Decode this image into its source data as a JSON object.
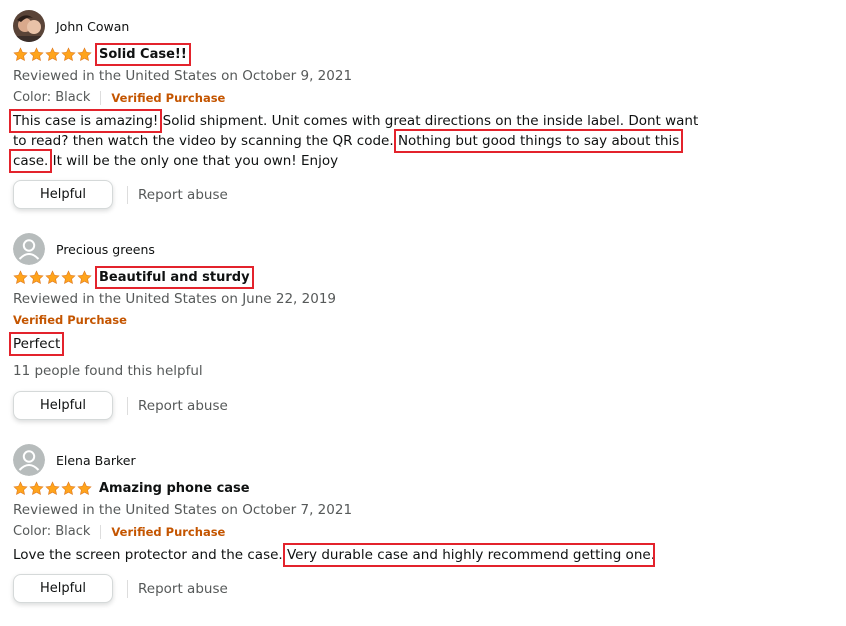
{
  "reviews": [
    {
      "reviewer": "John Cowan",
      "avatar": "profile-photo",
      "rating": 5,
      "title": "Solid Case!!",
      "date_line": "Reviewed in the United States on October 9, 2021",
      "color": "Color: Black",
      "verified": "Verified Purchase",
      "body_parts": [
        "This case is amazing!",
        " Solid shipment. Unit comes with great directions on the inside label. Dont want to read? then watch the video by scanning the QR code. ",
        "Nothing but good things to say about this case.",
        " It will be the only one that you own! Enjoy"
      ],
      "helpful_label": "Helpful",
      "report_label": "Report abuse"
    },
    {
      "reviewer": "Precious greens",
      "avatar": "default-avatar",
      "rating": 5,
      "title": "Beautiful and sturdy",
      "date_line": "Reviewed in the United States on June 22, 2019",
      "verified": "Verified Purchase",
      "body_parts": [
        "Perfect"
      ],
      "helpful_count": "11 people found this helpful",
      "helpful_label": "Helpful",
      "report_label": "Report abuse"
    },
    {
      "reviewer": "Elena Barker",
      "avatar": "default-avatar",
      "rating": 5,
      "title": "Amazing phone case",
      "date_line": "Reviewed in the United States on October 7, 2021",
      "color": "Color: Black",
      "verified": "Verified Purchase",
      "body_parts": [
        "Love the screen protector and the case. ",
        "Very durable case and highly recommend getting one",
        "."
      ],
      "helpful_label": "Helpful",
      "report_label": "Report abuse"
    }
  ],
  "colors": {
    "star": "#ffa41c",
    "verified": "#c45500",
    "highlight": "#e3232c"
  }
}
